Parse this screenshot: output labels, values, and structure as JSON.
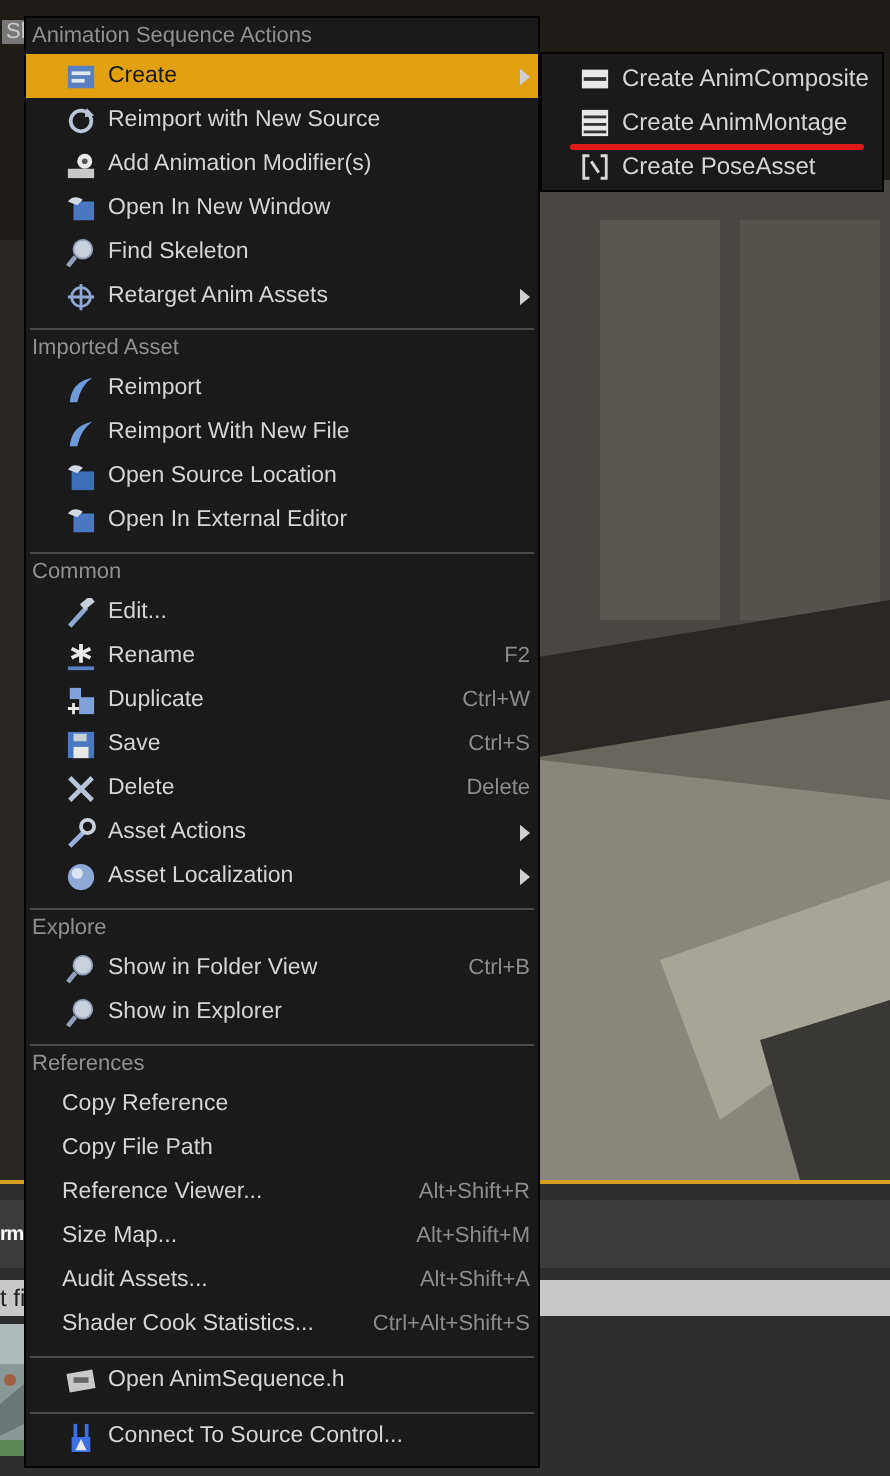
{
  "background": {
    "tab_fragment": "Sl",
    "panel_title_fragment": "rm",
    "filter_fragment": "t fi"
  },
  "context_menu": {
    "sections": [
      {
        "title": "Animation Sequence Actions",
        "items": [
          {
            "label": "Create",
            "kind": "create",
            "submenu": true,
            "selected": true
          },
          {
            "label": "Reimport with New Source",
            "kind": "refresh",
            "submenu": false,
            "selected": false
          },
          {
            "label": "Add Animation Modifier(s)",
            "kind": "gear",
            "submenu": false,
            "selected": false
          },
          {
            "label": "Open In New Window",
            "kind": "window",
            "submenu": false,
            "selected": false
          },
          {
            "label": "Find Skeleton",
            "kind": "search",
            "submenu": false,
            "selected": false
          },
          {
            "label": "Retarget Anim Assets",
            "kind": "crosshair",
            "submenu": true,
            "selected": false
          }
        ]
      },
      {
        "title": "Imported Asset",
        "items": [
          {
            "label": "Reimport",
            "kind": "swoosh",
            "submenu": false,
            "selected": false
          },
          {
            "label": "Reimport With New File",
            "kind": "swoosh",
            "submenu": false,
            "selected": false
          },
          {
            "label": "Open Source Location",
            "kind": "folder",
            "submenu": false,
            "selected": false
          },
          {
            "label": "Open In External Editor",
            "kind": "window",
            "submenu": false,
            "selected": false
          }
        ]
      },
      {
        "title": "Common",
        "items": [
          {
            "label": "Edit...",
            "kind": "hammer",
            "submenu": false,
            "selected": false
          },
          {
            "label": "Rename",
            "kind": "asterisk",
            "shortcut": "F2",
            "submenu": false,
            "selected": false
          },
          {
            "label": "Duplicate",
            "kind": "copy",
            "shortcut": "Ctrl+W",
            "submenu": false,
            "selected": false
          },
          {
            "label": "Save",
            "kind": "save",
            "shortcut": "Ctrl+S",
            "submenu": false,
            "selected": false
          },
          {
            "label": "Delete",
            "kind": "cross",
            "shortcut": "Delete",
            "submenu": false,
            "selected": false
          },
          {
            "label": "Asset Actions",
            "kind": "wrench",
            "submenu": true,
            "selected": false
          },
          {
            "label": "Asset Localization",
            "kind": "sphere",
            "submenu": true,
            "selected": false
          }
        ]
      },
      {
        "title": "Explore",
        "items": [
          {
            "label": "Show in Folder View",
            "kind": "search",
            "shortcut": "Ctrl+B",
            "submenu": false,
            "selected": false
          },
          {
            "label": "Show in Explorer",
            "kind": "search",
            "submenu": false,
            "selected": false
          }
        ]
      },
      {
        "title": "References",
        "items": [
          {
            "label": "Copy Reference",
            "kind": "text",
            "submenu": false,
            "selected": false
          },
          {
            "label": "Copy File Path",
            "kind": "text",
            "submenu": false,
            "selected": false
          },
          {
            "label": "Reference Viewer...",
            "kind": "text",
            "shortcut": "Alt+Shift+R",
            "submenu": false,
            "selected": false
          },
          {
            "label": "Size Map...",
            "kind": "text",
            "shortcut": "Alt+Shift+M",
            "submenu": false,
            "selected": false
          },
          {
            "label": "Audit Assets...",
            "kind": "text",
            "shortcut": "Alt+Shift+A",
            "submenu": false,
            "selected": false
          },
          {
            "label": "Shader Cook Statistics...",
            "kind": "text",
            "shortcut": "Ctrl+Alt+Shift+S",
            "submenu": false,
            "selected": false
          }
        ]
      },
      {
        "items": [
          {
            "label": "Open AnimSequence.h",
            "kind": "code",
            "submenu": false,
            "selected": false
          }
        ]
      },
      {
        "items": [
          {
            "label": "Connect To Source Control...",
            "kind": "plug",
            "submenu": false,
            "selected": false
          }
        ]
      }
    ]
  },
  "create_submenu": {
    "items": [
      {
        "label": "Create AnimComposite",
        "kind": "film",
        "underlined": false
      },
      {
        "label": "Create AnimMontage",
        "kind": "list",
        "underlined": true
      },
      {
        "label": "Create PoseAsset",
        "kind": "bracket",
        "underlined": false
      }
    ]
  }
}
